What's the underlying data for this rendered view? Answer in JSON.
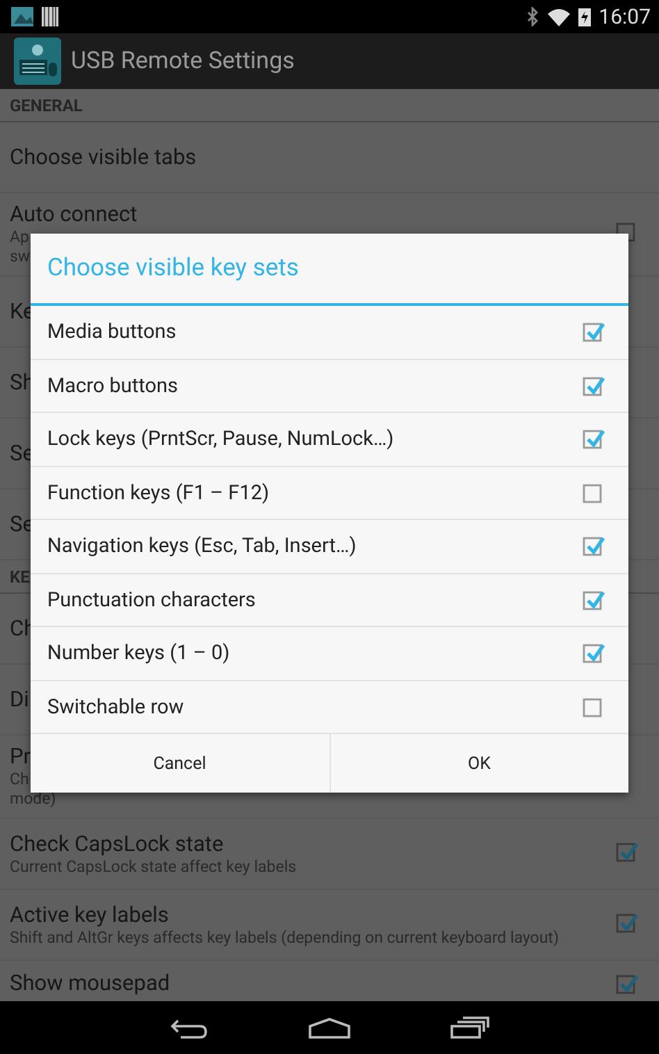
{
  "status_bar": {
    "time": "16:07"
  },
  "action_bar": {
    "title": "USB Remote Settings"
  },
  "preferences": [
    {
      "kind": "header",
      "title": "GENERAL"
    },
    {
      "kind": "item",
      "title": "Choose visible tabs"
    },
    {
      "kind": "check",
      "title": "Auto connect",
      "summary_lines": [
        "Ap",
        "sw"
      ],
      "checked": false
    },
    {
      "kind": "item",
      "title": "Ke"
    },
    {
      "kind": "item",
      "title": "Sh"
    },
    {
      "kind": "item",
      "title": "Se"
    },
    {
      "kind": "item",
      "title": "Se"
    },
    {
      "kind": "header",
      "title": "KE"
    },
    {
      "kind": "item",
      "title": "Ch"
    },
    {
      "kind": "item",
      "title": "Di"
    },
    {
      "kind": "item",
      "title": "Pr",
      "summary_lines": [
        "Ch",
        "mode)"
      ]
    },
    {
      "kind": "check",
      "title": "Check CapsLock state",
      "summary_lines": [
        "Current CapsLock state affect key labels"
      ],
      "checked": true
    },
    {
      "kind": "check",
      "title": "Active key labels",
      "summary_lines": [
        "Shift and AltGr keys affects key labels (depending on current keyboard layout)"
      ],
      "checked": true
    },
    {
      "kind": "check",
      "title": "Show mousepad",
      "checked": true
    }
  ],
  "dialog": {
    "title": "Choose visible key sets",
    "options": [
      {
        "label": "Media buttons",
        "checked": true
      },
      {
        "label": "Macro buttons",
        "checked": true
      },
      {
        "label": "Lock keys (PrntScr, Pause, NumLock…)",
        "checked": true
      },
      {
        "label": "Function keys (F1 – F12)",
        "checked": false
      },
      {
        "label": "Navigation keys (Esc, Tab, Insert…)",
        "checked": true
      },
      {
        "label": "Punctuation characters",
        "checked": true
      },
      {
        "label": "Number keys (1 – 0)",
        "checked": true
      },
      {
        "label": "Switchable row",
        "checked": false
      }
    ],
    "buttons": [
      "Cancel",
      "OK"
    ]
  }
}
